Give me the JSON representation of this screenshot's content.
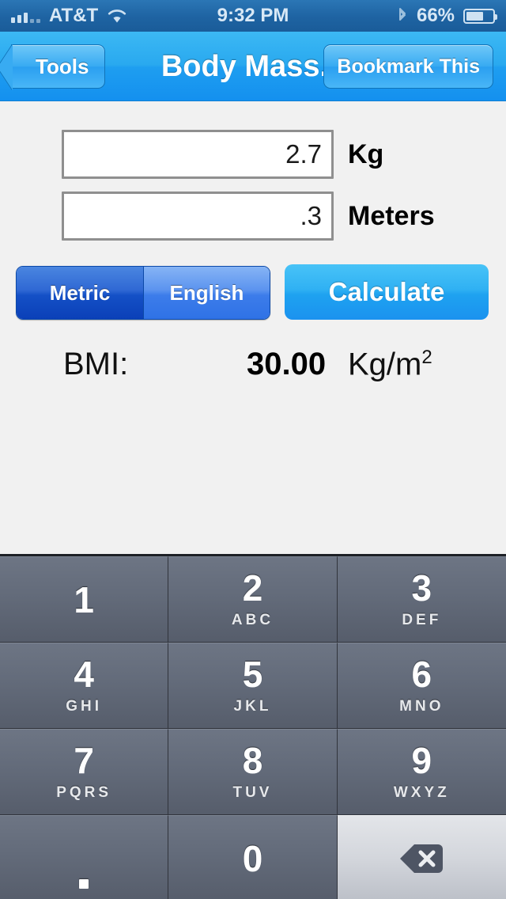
{
  "status_bar": {
    "carrier": "AT&T",
    "time": "9:32 PM",
    "battery_percent": "66%",
    "battery_level": 66,
    "signal_bars": 3,
    "icons": [
      "signal-bars-icon",
      "wifi-icon",
      "bluetooth-icon",
      "battery-icon"
    ]
  },
  "nav_bar": {
    "back_label": "Tools",
    "title": "Body Mass...",
    "bookmark_label": "Bookmark This"
  },
  "form": {
    "weight": {
      "value": "2.7",
      "placeholder": "",
      "unit": "Kg"
    },
    "height": {
      "value": ".3",
      "placeholder": "",
      "unit": "Meters"
    },
    "units_segments": [
      {
        "label": "Metric",
        "selected": true
      },
      {
        "label": "English",
        "selected": false
      }
    ],
    "calculate_label": "Calculate"
  },
  "result": {
    "label": "BMI:",
    "value": "30.00",
    "unit_prefix": "Kg/m",
    "unit_exponent": "2"
  },
  "keypad": {
    "rows": [
      [
        {
          "num": "1",
          "letters": ""
        },
        {
          "num": "2",
          "letters": "ABC"
        },
        {
          "num": "3",
          "letters": "DEF"
        }
      ],
      [
        {
          "num": "4",
          "letters": "GHI"
        },
        {
          "num": "5",
          "letters": "JKL"
        },
        {
          "num": "6",
          "letters": "MNO"
        }
      ],
      [
        {
          "num": "7",
          "letters": "PQRS"
        },
        {
          "num": "8",
          "letters": "TUV"
        },
        {
          "num": "9",
          "letters": "WXYZ"
        }
      ],
      [
        {
          "num": ".",
          "letters": "",
          "type": "decimal"
        },
        {
          "num": "0",
          "letters": ""
        },
        {
          "num": "",
          "letters": "",
          "type": "delete",
          "icon": "backspace-icon"
        }
      ]
    ]
  },
  "colors": {
    "nav_blue": "#1e9ef0",
    "status_blue": "#1e63a2",
    "accent_calculate": "#1ea2f0",
    "segment_selected": "#1450c6",
    "segment_unselected": "#3c7cea",
    "key_dark": "#636b7a",
    "key_light": "#d3d6dc",
    "content_bg": "#f1f1f1"
  }
}
